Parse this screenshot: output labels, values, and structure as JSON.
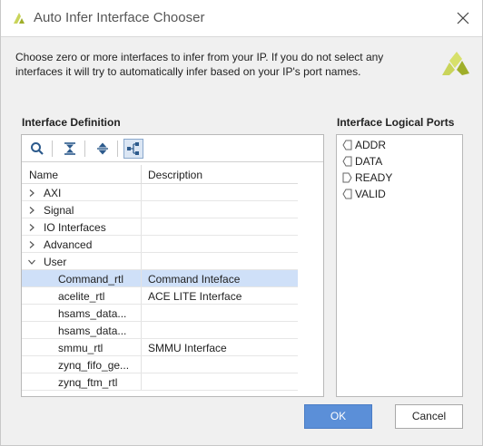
{
  "window": {
    "title": "Auto Infer Interface Chooser",
    "logo_icon": "xilinx-logo-icon",
    "close_icon": "close-icon"
  },
  "description": "Choose zero or more interfaces to infer from your IP. If you do not select any interfaces it will try to automatically infer based on your IP's port names.",
  "interface_definition": {
    "label": "Interface Definition",
    "toolbar": [
      "search-icon",
      "collapse-all-icon",
      "expand-all-icon",
      "hierarchy-view-icon"
    ],
    "columns": [
      "Name",
      "Description"
    ],
    "rows": [
      {
        "name": "AXI",
        "description": "",
        "expanded": false,
        "level": 0
      },
      {
        "name": "Signal",
        "description": "",
        "expanded": false,
        "level": 0
      },
      {
        "name": "IO Interfaces",
        "description": "",
        "expanded": false,
        "level": 0
      },
      {
        "name": "Advanced",
        "description": "",
        "expanded": false,
        "level": 0
      },
      {
        "name": "User",
        "description": "",
        "expanded": true,
        "level": 0
      },
      {
        "name": "Command_rtl",
        "description": "Command Inteface",
        "level": 1,
        "selected": true
      },
      {
        "name": "acelite_rtl",
        "description": "ACE LITE Interface",
        "level": 1
      },
      {
        "name": "hsams_data...",
        "description": "",
        "level": 1
      },
      {
        "name": "hsams_data...",
        "description": "",
        "level": 1
      },
      {
        "name": "smmu_rtl",
        "description": "SMMU Interface",
        "level": 1
      },
      {
        "name": "zynq_fifo_ge...",
        "description": "",
        "level": 1
      },
      {
        "name": "zynq_ftm_rtl",
        "description": "",
        "level": 1
      }
    ]
  },
  "interface_logical_ports": {
    "label": "Interface Logical Ports",
    "ports": [
      {
        "name": "ADDR",
        "direction": "input"
      },
      {
        "name": "DATA",
        "direction": "input"
      },
      {
        "name": "READY",
        "direction": "output"
      },
      {
        "name": "VALID",
        "direction": "input"
      }
    ]
  },
  "buttons": {
    "ok": "OK",
    "cancel": "Cancel"
  },
  "colors": {
    "selection": "#cfe0f8",
    "ok_button": "#5b8fd8",
    "brand_logo": "#c9d45a"
  }
}
